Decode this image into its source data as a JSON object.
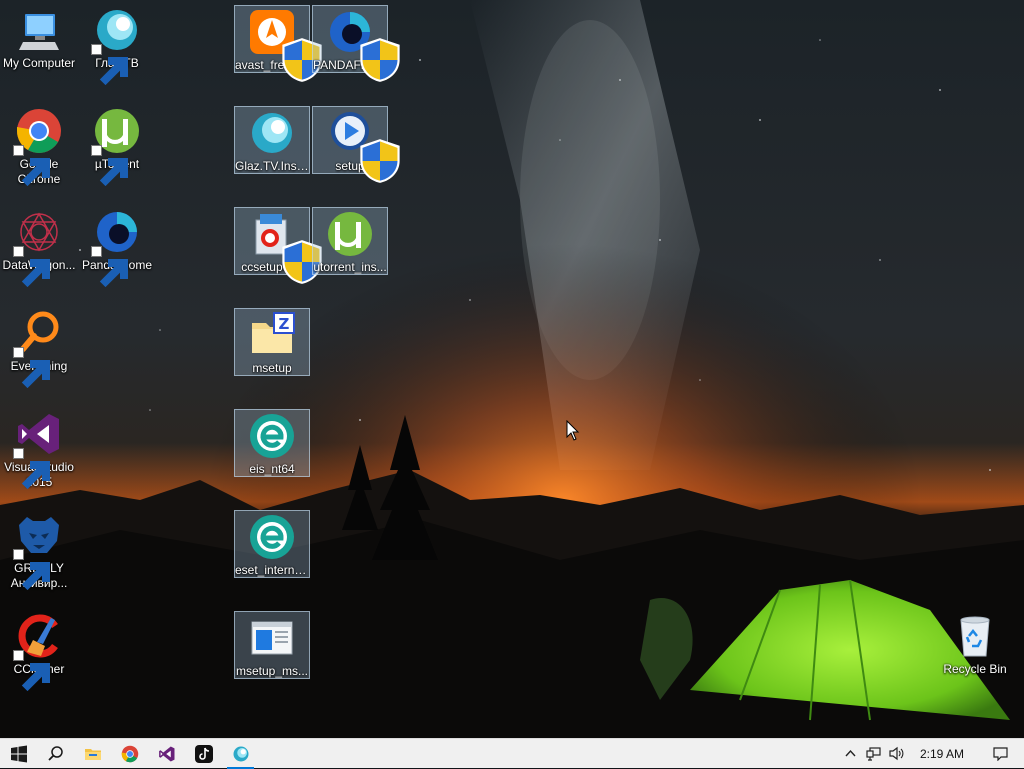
{
  "desktop": {
    "left_column": [
      {
        "label": "My Computer",
        "icon": "my-computer-icon"
      },
      {
        "label": "Google Chrome",
        "icon": "chrome-icon"
      },
      {
        "label": "DataWagon...",
        "icon": "datawagon-icon"
      },
      {
        "label": "Everything",
        "icon": "everything-icon"
      },
      {
        "label": "Visual Studio 2015",
        "icon": "visual-studio-icon"
      },
      {
        "label": "GRIZZLY Антивир...",
        "icon": "grizzly-icon"
      },
      {
        "label": "CCleaner",
        "icon": "ccleaner-icon"
      }
    ],
    "second_column": [
      {
        "label": "Глаз.ТВ",
        "icon": "glaz-tv-icon"
      },
      {
        "label": "µTorrent",
        "icon": "utorrent-icon"
      },
      {
        "label": "Panda Dome",
        "icon": "panda-dome-icon"
      }
    ],
    "selected_files": [
      {
        "label": "avast_free_a...",
        "icon": "avast-installer-icon"
      },
      {
        "label": "PANDAFRE...",
        "icon": "panda-installer-icon"
      },
      {
        "label": "Glaz.TV.Inst...",
        "icon": "glaz-tv-installer-icon"
      },
      {
        "label": "setup",
        "icon": "setup-icon"
      },
      {
        "label": "ccsetup608",
        "icon": "ccsetup-icon"
      },
      {
        "label": "utorrent_ins...",
        "icon": "utorrent-installer-icon"
      },
      {
        "label": "msetup",
        "icon": "zip-folder-icon"
      },
      {
        "label": "eis_nt64",
        "icon": "eset-icon"
      },
      {
        "label": "eset_interne...",
        "icon": "eset-icon"
      },
      {
        "label": "msetup_ms...",
        "icon": "window-app-icon"
      }
    ],
    "recycle_bin": {
      "label": "Recycle Bin",
      "icon": "recycle-bin-icon"
    }
  },
  "taskbar": {
    "buttons": [
      {
        "name": "start-button",
        "icon": "windows-logo-icon"
      },
      {
        "name": "search-button",
        "icon": "search-icon"
      },
      {
        "name": "file-explorer-button",
        "icon": "folder-icon"
      },
      {
        "name": "chrome-button",
        "icon": "chrome-icon"
      },
      {
        "name": "visual-studio-button",
        "icon": "visual-studio-icon"
      },
      {
        "name": "tiktok-button",
        "icon": "tiktok-icon"
      },
      {
        "name": "glaz-tv-button",
        "icon": "glaz-tv-icon"
      }
    ],
    "tray": {
      "time": "2:19 AM"
    }
  },
  "colors": {
    "taskbar_bg": "#f0f0f0",
    "selection_fill": "#a0bed7",
    "tent": "#8fe03a",
    "sunset": "#e07020"
  }
}
